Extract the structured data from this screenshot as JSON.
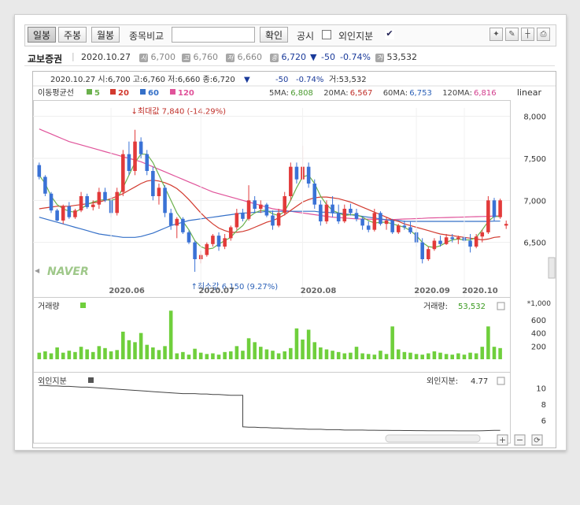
{
  "toolbar": {
    "daily": "일봉",
    "weekly": "주봉",
    "monthly": "월봉",
    "compare_label": "종목비교",
    "compare_value": "",
    "confirm": "확인",
    "disclosure": "공시",
    "foreign_label": "외인지분",
    "foreign_check": "✔"
  },
  "stock": {
    "name": "교보증권",
    "date": "2020.10.27",
    "open_icon": "시",
    "open": "6,700",
    "high_icon": "고",
    "high": "6,760",
    "low_icon": "저",
    "low": "6,660",
    "close_icon": "종",
    "close": "6,720",
    "change_arrow": "▼",
    "change": "-50",
    "change_pct": "-0.74%",
    "volume_icon": "거",
    "volume": "53,532"
  },
  "header": {
    "text": "2020.10.27  시:6,700  고:6,760  저:6,660  종:6,720",
    "arrow": "▼",
    "change": "-50",
    "pct": "-0.74%",
    "vol": "거:53,532"
  },
  "ma": {
    "title": "이동평균선",
    "legend": [
      {
        "label": "5",
        "color": "#6ab04c"
      },
      {
        "label": "20",
        "color": "#d23a2f"
      },
      {
        "label": "60",
        "color": "#3570c8"
      },
      {
        "label": "120",
        "color": "#e0539a"
      }
    ],
    "values": [
      {
        "label": "5MA:",
        "value": "6,808",
        "color": "#4a9a2f"
      },
      {
        "label": "20MA:",
        "value": "6,567",
        "color": "#c0302a"
      },
      {
        "label": "60MA:",
        "value": "6,753",
        "color": "#2d62b8"
      },
      {
        "label": "120MA:",
        "value": "6,816",
        "color": "#d23c8c"
      }
    ],
    "scale": "linear"
  },
  "annotations": {
    "max": "최대값 7,840 (-14.29%)",
    "min": "최소값 6,150 (9.27%)"
  },
  "watermark": "NAVER",
  "volume_panel": {
    "title": "거래량",
    "value_label": "거래량:",
    "value": "53,532",
    "unit": "*1,000"
  },
  "foreign_panel": {
    "title": "외인지분",
    "value_label": "외인지분:",
    "value": "4.77"
  },
  "colors": {
    "up": "#e23a3a",
    "down": "#3a72d6",
    "volume": "#6fcf3c"
  },
  "chart_data": {
    "type": "candlestick",
    "x_ticks": [
      "2020.06",
      "2020.07",
      "2020.08",
      "2020.09",
      "2020.10"
    ],
    "price_axis": {
      "ticks": [
        6500,
        7000,
        7500,
        8000
      ],
      "labels": [
        "6,500",
        "7,000",
        "7,500",
        "8,000"
      ],
      "ylim": [
        6000,
        8100
      ]
    },
    "candles": [
      {
        "o": 7420,
        "h": 7450,
        "l": 7250,
        "c": 7280
      },
      {
        "o": 7280,
        "h": 7300,
        "l": 7050,
        "c": 7080
      },
      {
        "o": 7080,
        "h": 7100,
        "l": 6850,
        "c": 6880
      },
      {
        "o": 6880,
        "h": 6900,
        "l": 6750,
        "c": 6760
      },
      {
        "o": 6760,
        "h": 6950,
        "l": 6720,
        "c": 6930
      },
      {
        "o": 6930,
        "h": 6980,
        "l": 6780,
        "c": 6800
      },
      {
        "o": 6800,
        "h": 6900,
        "l": 6780,
        "c": 6880
      },
      {
        "o": 6880,
        "h": 7100,
        "l": 6860,
        "c": 7050
      },
      {
        "o": 7050,
        "h": 7080,
        "l": 6900,
        "c": 6920
      },
      {
        "o": 6920,
        "h": 7000,
        "l": 6880,
        "c": 6950
      },
      {
        "o": 6950,
        "h": 7150,
        "l": 6900,
        "c": 7100
      },
      {
        "o": 7100,
        "h": 7150,
        "l": 6980,
        "c": 7000
      },
      {
        "o": 7000,
        "h": 7050,
        "l": 6800,
        "c": 6850
      },
      {
        "o": 6850,
        "h": 7150,
        "l": 6820,
        "c": 7100
      },
      {
        "o": 7100,
        "h": 7600,
        "l": 7050,
        "c": 7550
      },
      {
        "o": 7550,
        "h": 7700,
        "l": 7300,
        "c": 7350
      },
      {
        "o": 7350,
        "h": 7840,
        "l": 7300,
        "c": 7700
      },
      {
        "o": 7700,
        "h": 7750,
        "l": 7500,
        "c": 7550
      },
      {
        "o": 7550,
        "h": 7600,
        "l": 7300,
        "c": 7350
      },
      {
        "o": 7350,
        "h": 7400,
        "l": 7000,
        "c": 7050
      },
      {
        "o": 7050,
        "h": 7200,
        "l": 6950,
        "c": 7150
      },
      {
        "o": 7150,
        "h": 7180,
        "l": 6800,
        "c": 6850
      },
      {
        "o": 6850,
        "h": 6900,
        "l": 6650,
        "c": 6700
      },
      {
        "o": 6700,
        "h": 6800,
        "l": 6550,
        "c": 6780
      },
      {
        "o": 6780,
        "h": 6800,
        "l": 6600,
        "c": 6620
      },
      {
        "o": 6620,
        "h": 6640,
        "l": 6480,
        "c": 6500
      },
      {
        "o": 6500,
        "h": 6520,
        "l": 6150,
        "c": 6300
      },
      {
        "o": 6300,
        "h": 6400,
        "l": 6250,
        "c": 6350
      },
      {
        "o": 6350,
        "h": 6500,
        "l": 6330,
        "c": 6480
      },
      {
        "o": 6480,
        "h": 6600,
        "l": 6450,
        "c": 6580
      },
      {
        "o": 6580,
        "h": 6620,
        "l": 6400,
        "c": 6450
      },
      {
        "o": 6450,
        "h": 6600,
        "l": 6420,
        "c": 6550
      },
      {
        "o": 6550,
        "h": 6700,
        "l": 6520,
        "c": 6680
      },
      {
        "o": 6680,
        "h": 6900,
        "l": 6650,
        "c": 6850
      },
      {
        "o": 6850,
        "h": 6900,
        "l": 6750,
        "c": 6780
      },
      {
        "o": 6780,
        "h": 7180,
        "l": 6760,
        "c": 7000
      },
      {
        "o": 7000,
        "h": 7050,
        "l": 6850,
        "c": 6900
      },
      {
        "o": 6900,
        "h": 7000,
        "l": 6850,
        "c": 6950
      },
      {
        "o": 6950,
        "h": 6970,
        "l": 6800,
        "c": 6820
      },
      {
        "o": 6820,
        "h": 6880,
        "l": 6650,
        "c": 6700
      },
      {
        "o": 6700,
        "h": 6900,
        "l": 6680,
        "c": 6850
      },
      {
        "o": 6850,
        "h": 7100,
        "l": 6820,
        "c": 7050
      },
      {
        "o": 7050,
        "h": 7450,
        "l": 7000,
        "c": 7400
      },
      {
        "o": 7400,
        "h": 7450,
        "l": 7200,
        "c": 7250
      },
      {
        "o": 7250,
        "h": 7650,
        "l": 7200,
        "c": 7400
      },
      {
        "o": 7400,
        "h": 7450,
        "l": 7150,
        "c": 7200
      },
      {
        "o": 7200,
        "h": 7250,
        "l": 6900,
        "c": 6950
      },
      {
        "o": 6950,
        "h": 7000,
        "l": 6700,
        "c": 6750
      },
      {
        "o": 6750,
        "h": 7000,
        "l": 6720,
        "c": 6950
      },
      {
        "o": 6950,
        "h": 7050,
        "l": 6800,
        "c": 6850
      },
      {
        "o": 6850,
        "h": 6950,
        "l": 6720,
        "c": 6750
      },
      {
        "o": 6750,
        "h": 6950,
        "l": 6730,
        "c": 6900
      },
      {
        "o": 6900,
        "h": 6960,
        "l": 6820,
        "c": 6850
      },
      {
        "o": 6850,
        "h": 6900,
        "l": 6750,
        "c": 6780
      },
      {
        "o": 6780,
        "h": 6800,
        "l": 6650,
        "c": 6700
      },
      {
        "o": 6700,
        "h": 6750,
        "l": 6620,
        "c": 6650
      },
      {
        "o": 6650,
        "h": 6900,
        "l": 6630,
        "c": 6850
      },
      {
        "o": 6850,
        "h": 6870,
        "l": 6700,
        "c": 6720
      },
      {
        "o": 6720,
        "h": 6800,
        "l": 6650,
        "c": 6760
      },
      {
        "o": 6760,
        "h": 6780,
        "l": 6600,
        "c": 6620
      },
      {
        "o": 6620,
        "h": 6720,
        "l": 6600,
        "c": 6700
      },
      {
        "o": 6700,
        "h": 6760,
        "l": 6650,
        "c": 6680
      },
      {
        "o": 6680,
        "h": 6750,
        "l": 6600,
        "c": 6620
      },
      {
        "o": 6620,
        "h": 6660,
        "l": 6450,
        "c": 6500
      },
      {
        "o": 6500,
        "h": 6550,
        "l": 6250,
        "c": 6300
      },
      {
        "o": 6300,
        "h": 6450,
        "l": 6280,
        "c": 6420
      },
      {
        "o": 6420,
        "h": 6550,
        "l": 6400,
        "c": 6520
      },
      {
        "o": 6520,
        "h": 6580,
        "l": 6450,
        "c": 6480
      },
      {
        "o": 6480,
        "h": 6600,
        "l": 6470,
        "c": 6560
      },
      {
        "o": 6560,
        "h": 6600,
        "l": 6500,
        "c": 6540
      },
      {
        "o": 6540,
        "h": 6580,
        "l": 6480,
        "c": 6560
      },
      {
        "o": 6560,
        "h": 6600,
        "l": 6500,
        "c": 6520
      },
      {
        "o": 6520,
        "h": 6600,
        "l": 6380,
        "c": 6450
      },
      {
        "o": 6450,
        "h": 6600,
        "l": 6430,
        "c": 6570
      },
      {
        "o": 6570,
        "h": 6650,
        "l": 6500,
        "c": 6620
      },
      {
        "o": 6620,
        "h": 7050,
        "l": 6600,
        "c": 7000
      },
      {
        "o": 7000,
        "h": 7030,
        "l": 6750,
        "c": 6800
      },
      {
        "o": 6800,
        "h": 7020,
        "l": 6780,
        "c": 7000
      },
      {
        "o": 6700,
        "h": 6760,
        "l": 6660,
        "c": 6720
      }
    ],
    "ma5": [
      7300,
      7200,
      7050,
      6950,
      6900,
      6870,
      6860,
      6900,
      6950,
      6980,
      7000,
      7010,
      7000,
      7020,
      7150,
      7300,
      7450,
      7550,
      7550,
      7450,
      7300,
      7150,
      7000,
      6850,
      6750,
      6650,
      6520,
      6450,
      6420,
      6430,
      6480,
      6520,
      6560,
      6640,
      6700,
      6800,
      6850,
      6880,
      6880,
      6840,
      6820,
      6870,
      7000,
      7150,
      7280,
      7300,
      7200,
      7050,
      6950,
      6880,
      6850,
      6820,
      6830,
      6830,
      6800,
      6760,
      6730,
      6740,
      6740,
      6720,
      6700,
      6680,
      6640,
      6580,
      6500,
      6450,
      6440,
      6460,
      6500,
      6530,
      6540,
      6530,
      6530,
      6560,
      6650,
      6750,
      6810,
      6808
    ],
    "ma20": [
      6900,
      6910,
      6920,
      6930,
      6930,
      6930,
      6940,
      6950,
      6960,
      6970,
      6980,
      7000,
      7020,
      7050,
      7080,
      7120,
      7160,
      7200,
      7230,
      7240,
      7230,
      7210,
      7180,
      7140,
      7080,
      7010,
      6930,
      6850,
      6780,
      6720,
      6670,
      6640,
      6620,
      6620,
      6630,
      6650,
      6680,
      6710,
      6740,
      6760,
      6790,
      6830,
      6880,
      6930,
      6980,
      7010,
      7030,
      7040,
      7040,
      7030,
      7020,
      7000,
      6980,
      6950,
      6920,
      6890,
      6860,
      6830,
      6800,
      6770,
      6750,
      6720,
      6700,
      6680,
      6660,
      6640,
      6620,
      6600,
      6590,
      6580,
      6570,
      6560,
      6550,
      6540,
      6530,
      6540,
      6560,
      6567
    ],
    "ma60": [
      6800,
      6780,
      6760,
      6740,
      6720,
      6700,
      6680,
      6660,
      6640,
      6620,
      6600,
      6590,
      6580,
      6570,
      6560,
      6560,
      6560,
      6570,
      6590,
      6610,
      6640,
      6670,
      6700,
      6720,
      6740,
      6760,
      6770,
      6780,
      6790,
      6800,
      6810,
      6820,
      6830,
      6840,
      6850,
      6850,
      6860,
      6860,
      6870,
      6870,
      6870,
      6870,
      6870,
      6870,
      6870,
      6870,
      6870,
      6860,
      6860,
      6850,
      6850,
      6840,
      6830,
      6820,
      6810,
      6800,
      6790,
      6780,
      6770,
      6760,
      6760,
      6750,
      6750,
      6750,
      6750,
      6750,
      6750,
      6750,
      6750,
      6750,
      6750,
      6750,
      6750,
      6750,
      6750,
      6750,
      6753,
      6753
    ],
    "ma120": [
      7850,
      7820,
      7790,
      7760,
      7730,
      7700,
      7680,
      7660,
      7640,
      7620,
      7600,
      7580,
      7560,
      7540,
      7520,
      7500,
      7480,
      7460,
      7430,
      7400,
      7370,
      7340,
      7310,
      7280,
      7250,
      7220,
      7190,
      7160,
      7130,
      7100,
      7080,
      7060,
      7040,
      7020,
      7000,
      6980,
      6960,
      6940,
      6920,
      6900,
      6890,
      6880,
      6870,
      6860,
      6850,
      6840,
      6830,
      6820,
      6810,
      6800,
      6795,
      6790,
      6785,
      6780,
      6778,
      6776,
      6774,
      6772,
      6770,
      6772,
      6775,
      6778,
      6780,
      6783,
      6786,
      6790,
      6792,
      6794,
      6796,
      6798,
      6800,
      6802,
      6804,
      6806,
      6808,
      6810,
      6814,
      6816
    ],
    "volume": {
      "ticks": [
        200,
        400,
        600
      ],
      "labels": [
        "200",
        "400",
        "600"
      ],
      "ylim": [
        0,
        900
      ],
      "values": [
        100,
        120,
        90,
        180,
        100,
        130,
        110,
        190,
        150,
        110,
        200,
        170,
        120,
        140,
        420,
        290,
        260,
        400,
        220,
        180,
        140,
        200,
        740,
        90,
        110,
        70,
        160,
        100,
        80,
        90,
        70,
        110,
        120,
        200,
        130,
        320,
        260,
        190,
        150,
        130,
        90,
        120,
        170,
        470,
        300,
        450,
        260,
        180,
        150,
        130,
        110,
        90,
        100,
        190,
        90,
        80,
        70,
        130,
        80,
        500,
        150,
        110,
        100,
        80,
        70,
        90,
        120,
        100,
        80,
        70,
        90,
        70,
        100,
        90,
        190,
        500,
        190,
        170
      ]
    },
    "foreign": {
      "ticks": [
        6,
        8,
        10
      ],
      "labels": [
        "6",
        "8",
        "10"
      ],
      "ylim": [
        4.5,
        11.5
      ],
      "values": [
        10.3,
        10.3,
        10.25,
        10.25,
        10.2,
        10.2,
        10.15,
        10.1,
        10.1,
        10.05,
        10.0,
        9.95,
        9.9,
        9.85,
        9.8,
        9.75,
        9.7,
        9.65,
        9.6,
        9.55,
        9.5,
        9.45,
        9.4,
        9.35,
        9.3,
        9.3,
        9.3,
        9.25,
        9.25,
        9.2,
        9.2,
        9.15,
        9.1,
        9.1,
        5.2,
        5.15,
        5.15,
        5.1,
        5.1,
        5.05,
        5.05,
        5.0,
        5.0,
        4.95,
        4.95,
        4.9,
        4.9,
        4.9,
        4.85,
        4.85,
        4.85,
        4.8,
        4.8,
        4.8,
        4.8,
        4.78,
        4.78,
        4.76,
        4.76,
        4.75,
        4.75,
        4.74,
        4.74,
        4.73,
        4.73,
        4.72,
        4.72,
        4.72,
        4.71,
        4.71,
        4.7,
        4.7,
        4.7,
        4.7,
        4.72,
        4.74,
        4.76,
        4.77
      ]
    }
  }
}
